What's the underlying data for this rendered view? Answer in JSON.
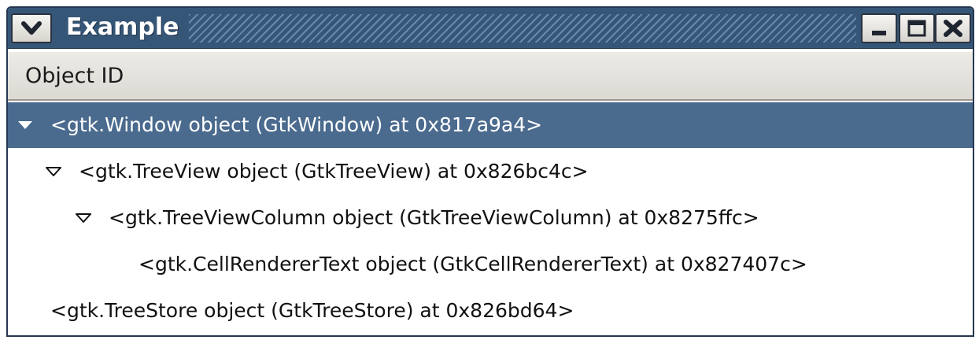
{
  "window": {
    "title": "Example",
    "menu_icon": "chevron-down-icon",
    "controls": [
      "minimize-icon",
      "maximize-icon",
      "close-icon"
    ],
    "colors": {
      "titlebar": "#355677",
      "selection": "#4a6a8e",
      "header": "#e3e1dc"
    }
  },
  "tree": {
    "column_header": "Object ID",
    "rows": [
      {
        "label": "<gtk.Window object (GtkWindow) at 0x817a9a4>",
        "expanded": true,
        "selected": true,
        "depth": 0
      },
      {
        "label": "<gtk.TreeView object (GtkTreeView) at 0x826bc4c>",
        "expanded": true,
        "selected": false,
        "depth": 1
      },
      {
        "label": "<gtk.TreeViewColumn object (GtkTreeViewColumn) at 0x8275ffc>",
        "expanded": true,
        "selected": false,
        "depth": 2
      },
      {
        "label": "<gtk.CellRendererText object (GtkCellRendererText) at 0x827407c>",
        "expanded": false,
        "selected": false,
        "depth": 3
      },
      {
        "label": "<gtk.TreeStore object (GtkTreeStore) at 0x826bd64>",
        "expanded": false,
        "selected": false,
        "depth": 0
      }
    ]
  }
}
